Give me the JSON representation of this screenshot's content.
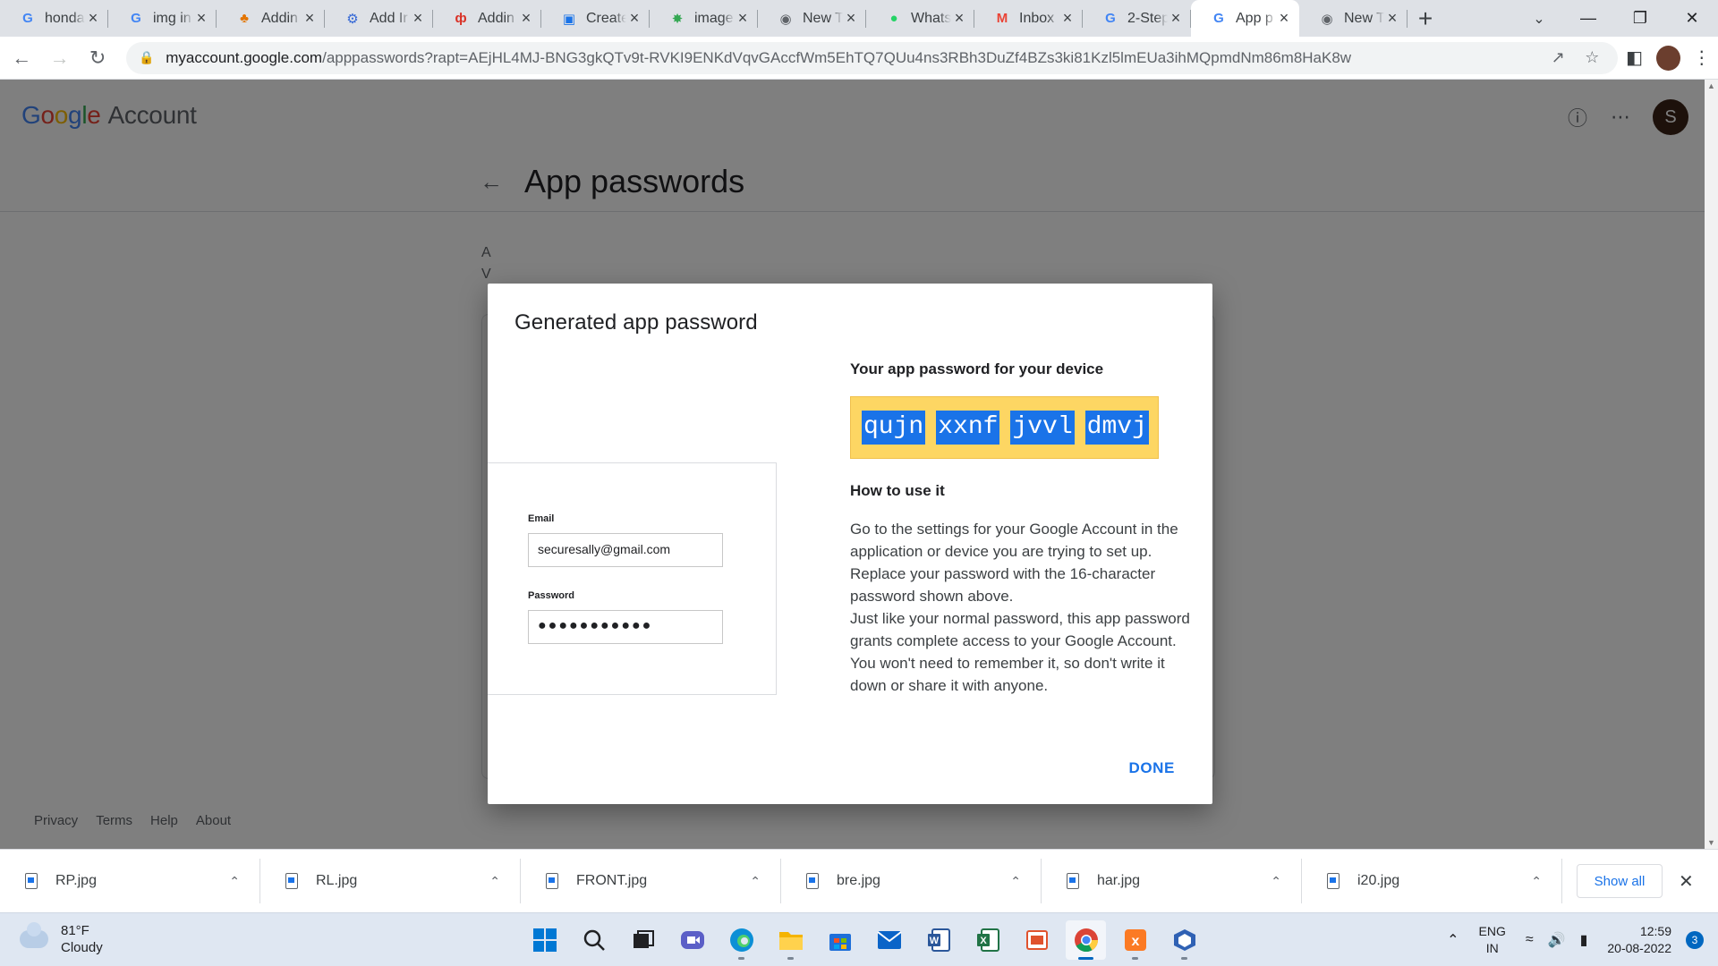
{
  "browser": {
    "tabs": [
      {
        "title": "honda",
        "favicon": "G",
        "color": "#4285f4",
        "active": false
      },
      {
        "title": "img in",
        "favicon": "G",
        "color": "#4285f4",
        "active": false
      },
      {
        "title": "Addin",
        "favicon": "♣",
        "color": "#e37400",
        "active": false
      },
      {
        "title": "Add Ir",
        "favicon": "⚙",
        "color": "#3367d6",
        "active": false
      },
      {
        "title": "Addin",
        "favicon": "ф",
        "color": "#d93025",
        "active": false
      },
      {
        "title": "Create",
        "favicon": "▣",
        "color": "#1a73e8",
        "active": false
      },
      {
        "title": "image",
        "favicon": "✸",
        "color": "#34a853",
        "active": false
      },
      {
        "title": "New T",
        "favicon": "◉",
        "color": "#5f6368",
        "active": false
      },
      {
        "title": "Whats",
        "favicon": "●",
        "color": "#25d366",
        "active": false
      },
      {
        "title": "Inbox",
        "favicon": "M",
        "color": "#ea4335",
        "active": false
      },
      {
        "title": "2-Step",
        "favicon": "G",
        "color": "#4285f4",
        "active": false
      },
      {
        "title": "App p",
        "favicon": "G",
        "color": "#4285f4",
        "active": true
      },
      {
        "title": "New T",
        "favicon": "◉",
        "color": "#5f6368",
        "active": false
      }
    ],
    "url_domain": "myaccount.google.com",
    "url_rest": "/apppasswords?rapt=AEjHL4MJ-BNG3gkQTv9t-RVKI9ENKdVqvGAccfWm5EhTQ7QUu4ns3RBh3DuZf4BZs3ki81Kzl5lmEUa3ihMQpmdNm86m8HaK8w"
  },
  "header": {
    "logo_google": [
      "G",
      "o",
      "o",
      "g",
      "l",
      "e"
    ],
    "logo_account": "Account",
    "avatar_letter": "S"
  },
  "page": {
    "title": "App passwords",
    "bg_text_1": "A",
    "bg_text_2": "V"
  },
  "footer": {
    "links": [
      "Privacy",
      "Terms",
      "Help",
      "About"
    ]
  },
  "dialog": {
    "title": "Generated app password",
    "mock_email_label": "Email",
    "mock_email_value": "securesally@gmail.com",
    "mock_password_label": "Password",
    "mock_password_dots": "●●●●●●●●●●●",
    "subtitle": "Your app password for your device",
    "password_groups": [
      "qujn",
      "xxnf",
      "jvvl",
      "dmvj"
    ],
    "how_title": "How to use it",
    "how_text_1": "Go to the settings for your Google Account in the application or device you are trying to set up. Replace your password with the 16-character password shown above.",
    "how_text_2": "Just like your normal password, this app password grants complete access to your Google Account. You won't need to remember it, so don't write it down or share it with anyone.",
    "done_label": "DONE"
  },
  "downloads": {
    "items": [
      "RP.jpg",
      "RL.jpg",
      "FRONT.jpg",
      "bre.jpg",
      "har.jpg",
      "i20.jpg"
    ],
    "show_all": "Show all"
  },
  "taskbar": {
    "temperature": "81°F",
    "condition": "Cloudy",
    "lang_1": "ENG",
    "lang_2": "IN",
    "time": "12:59",
    "date": "20-08-2022",
    "notifications": "3"
  }
}
